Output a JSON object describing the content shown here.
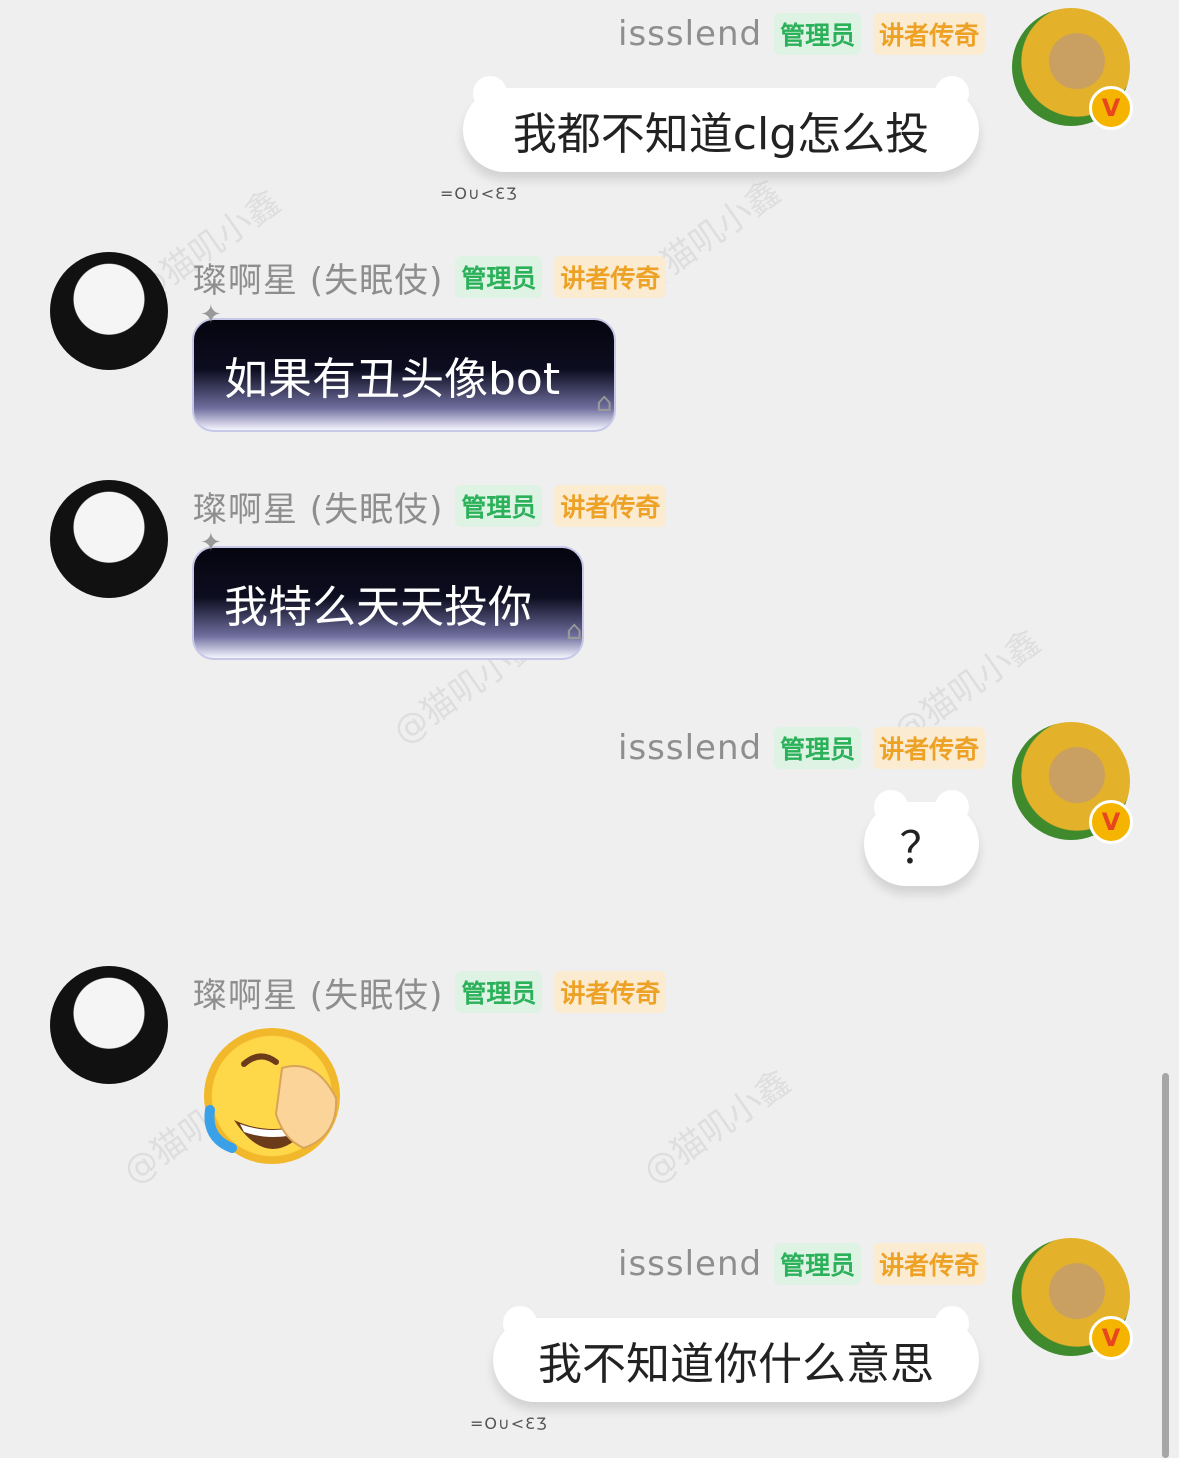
{
  "badges": {
    "admin": "管理员",
    "legend": "讲者传奇"
  },
  "watermark": "@猫叽小鑫",
  "bubble_deco": "=O∪<ƐƷ",
  "verified_mark": "V",
  "messages": [
    {
      "sender": "issslend",
      "side": "right",
      "text": "我都不知道clg怎么投"
    },
    {
      "sender": "璨啊星 (失眠伎)",
      "side": "left",
      "text": "如果有丑头像bot"
    },
    {
      "sender": "璨啊星 (失眠伎)",
      "side": "left",
      "text": "我特么天天投你"
    },
    {
      "sender": "issslend",
      "side": "right",
      "text": "？"
    },
    {
      "sender": "璨啊星 (失眠伎)",
      "side": "left",
      "emoji": "rolling-on-floor-laughing-facepalm"
    },
    {
      "sender": "issslend",
      "side": "right",
      "text": "我不知道你什么意思"
    }
  ]
}
